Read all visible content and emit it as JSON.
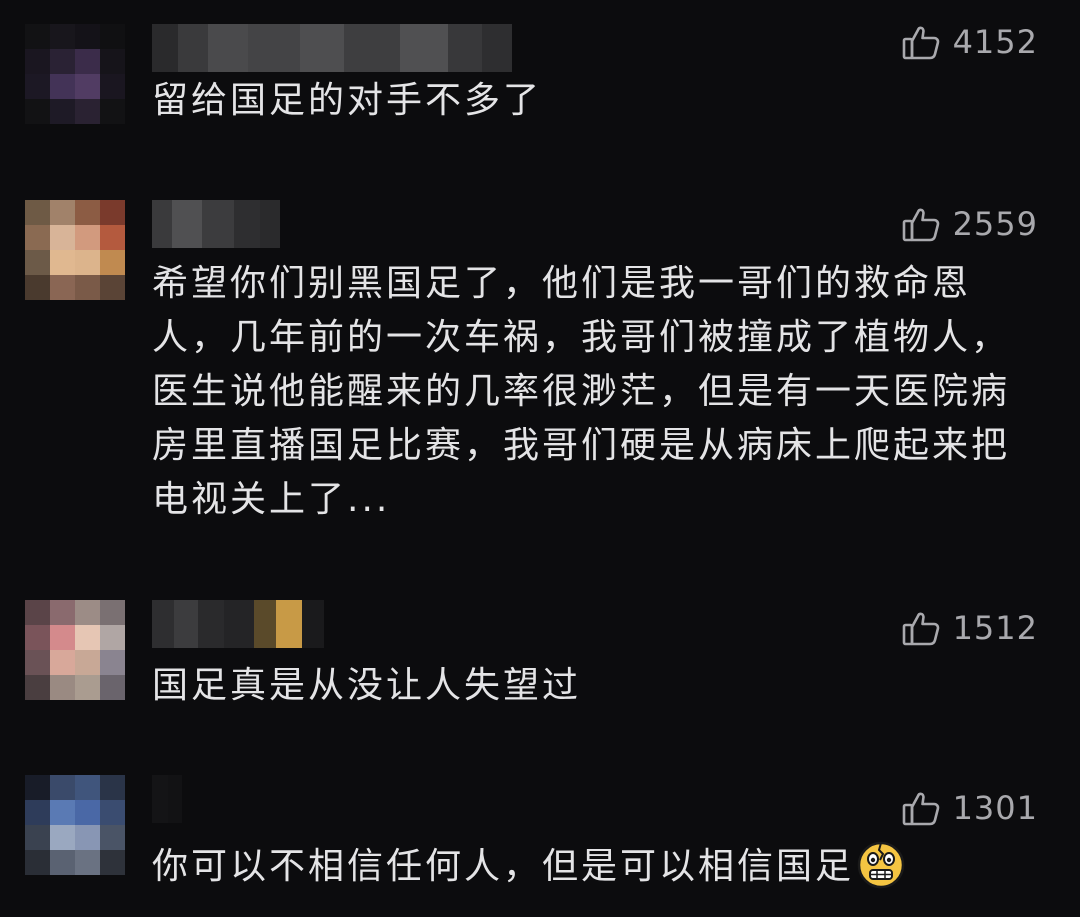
{
  "comments": [
    {
      "likes": "4152",
      "text": "留给国足的对手不多了",
      "avatar_colors": [
        "#121214",
        "#18161c",
        "#141218",
        "#101012",
        "#1a1620",
        "#2a2234",
        "#3b2c4a",
        "#16141a",
        "#1c1824",
        "#433357",
        "#513c63",
        "#1a1620",
        "#121214",
        "#1e1a26",
        "#2a2232",
        "#121214"
      ]
    },
    {
      "likes": "2559",
      "text": "希望你们别黑国足了，他们是我一哥们的救命恩人，几年前的一次车祸，我哥们被撞成了植物人，医生说他能醒来的几率很渺茫，但是有一天医院病房里直播国足比赛，我哥们硬是从病床上爬起来把电视关上了...",
      "avatar_colors": [
        "#6e5a45",
        "#a1826a",
        "#8c5c44",
        "#7a3a2c",
        "#8a6a52",
        "#d8b498",
        "#d29a7e",
        "#b45a3e",
        "#6c5a48",
        "#e0b890",
        "#dcb48c",
        "#c08a50",
        "#4a3a2e",
        "#8a6654",
        "#7a5a48",
        "#5a4436"
      ]
    },
    {
      "likes": "1512",
      "text": "国足真是从没让人失望过",
      "avatar_colors": [
        "#5a4448",
        "#8a6a6e",
        "#9c8c86",
        "#7a7072",
        "#7a545a",
        "#d48a8c",
        "#e6c6b4",
        "#b0a6a4",
        "#6a5256",
        "#d8a89a",
        "#c8a896",
        "#8a8490",
        "#4a3e40",
        "#9a8a82",
        "#aa9c90",
        "#6a646c"
      ]
    },
    {
      "likes": "1301",
      "text": "你可以不相信任何人，但是可以相信国足",
      "avatar_colors": [
        "#181c28",
        "#3a4a6a",
        "#40557c",
        "#2a3448",
        "#2e3c5a",
        "#5a7ab4",
        "#4a68a6",
        "#3a4c70",
        "#3a4250",
        "#9aa8c0",
        "#8896b4",
        "#4a5466",
        "#2a2e36",
        "#5a6272",
        "#6a7282",
        "#2e323a"
      ]
    }
  ],
  "usernames": [
    [
      "#2a2a2c",
      "#3a3a3c",
      "#4a4a4c",
      "#444446",
      "#4e4e50",
      "#3e3e40",
      "#505052",
      "#38383a",
      "#2e2e30"
    ],
    [
      "#3a3a3c",
      "#505052",
      "#3c3c3e",
      "#2e2e30",
      "#2a2a2c"
    ],
    [
      "#2e2e30",
      "#3c3c3e",
      "#2a2a2c",
      "#242426",
      "#5a4a2a",
      "#c89a46",
      "#1a1a1c"
    ],
    [
      "#141416",
      "#121214"
    ]
  ],
  "icons": {
    "like": "thumbs-up-icon",
    "emoji": "grimacing-face-icon"
  }
}
